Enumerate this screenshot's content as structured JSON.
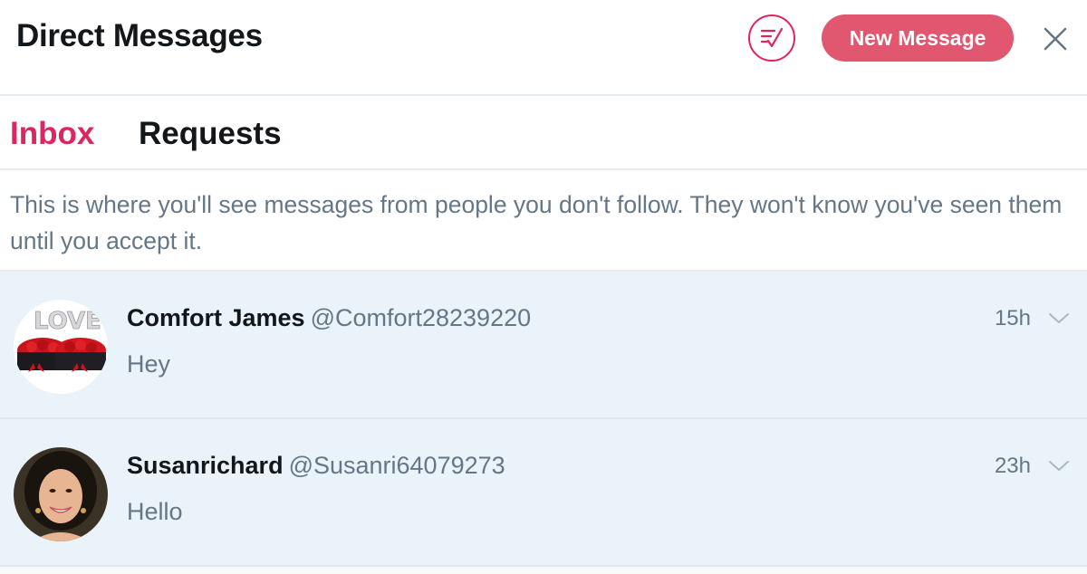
{
  "header": {
    "title": "Direct Messages",
    "mark_read_icon": "mark-all-read-icon",
    "new_message_label": "New Message",
    "close_icon": "close-icon",
    "accent_color": "#e0245e",
    "button_color": "#e0576f"
  },
  "tabs": [
    {
      "label": "Inbox",
      "active": true
    },
    {
      "label": "Requests",
      "active": false
    }
  ],
  "notice": {
    "text": "This is where you'll see messages from people you don't follow. They won't know you've seen them until you accept it."
  },
  "conversations": [
    {
      "name": "Comfort James",
      "handle": "@Comfort28239220",
      "time": "15h",
      "preview": "Hey",
      "avatar_icon": "love-roses-avatar"
    },
    {
      "name": "Susanrichard",
      "handle": "@Susanri64079273",
      "time": "23h",
      "preview": "Hello",
      "avatar_icon": "woman-portrait-avatar"
    }
  ],
  "colors": {
    "row_background": "#eaf2fa",
    "secondary_text": "#657786",
    "divider": "#e6ecf0"
  }
}
